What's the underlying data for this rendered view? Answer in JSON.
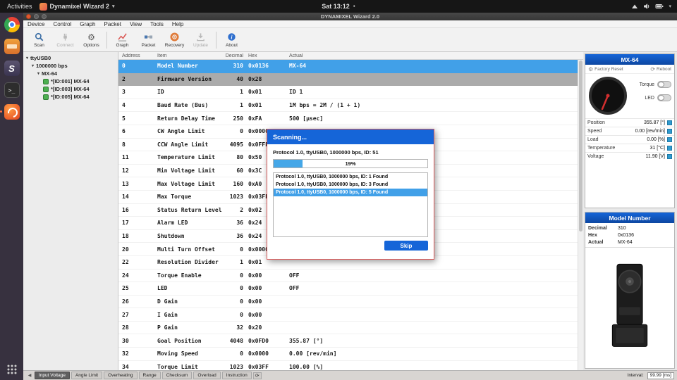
{
  "colors": {
    "accent_blue": "#1565d8",
    "selection_blue": "#41a0e8",
    "inactive_selection_gray": "#ababab",
    "progress_fill": "#45a7e8",
    "ubuntu_orange": "#e95420",
    "panel_bg": "#efefef"
  },
  "desktop": {
    "topbar": {
      "activities": "Activities",
      "app_menu": "Dynamixel Wizard 2",
      "caret": "▾",
      "clock": "Sat 13:12",
      "notification_dot": "●",
      "icons": [
        "network-icon",
        "volume-icon",
        "battery-icon",
        "chevron-down-icon"
      ]
    },
    "dock": {
      "items": [
        "chrome-icon",
        "files-icon",
        "s-app-icon",
        "terminal-icon",
        "dynamixel-wizard-icon"
      ],
      "active_item": "dynamixel-wizard-icon",
      "show_apps": "Show Applications"
    }
  },
  "window": {
    "title": "DYNAMIXEL Wizard 2.0",
    "menu": [
      "Device",
      "Control",
      "Graph",
      "Packet",
      "View",
      "Tools",
      "Help"
    ],
    "toolbar": [
      {
        "label": "Scan",
        "icon": "search-icon",
        "enabled": true
      },
      {
        "label": "Connect",
        "icon": "plug-icon",
        "enabled": false
      },
      {
        "label": "Options",
        "icon": "gear-icon",
        "enabled": true
      },
      {
        "separator": true
      },
      {
        "label": "Graph",
        "icon": "graph-icon",
        "enabled": true
      },
      {
        "label": "Packet",
        "icon": "packet-icon",
        "enabled": true
      },
      {
        "label": "Recovery",
        "icon": "recovery-icon",
        "enabled": true
      },
      {
        "label": "Update",
        "icon": "update-icon",
        "enabled": false
      },
      {
        "separator": true
      },
      {
        "label": "About",
        "icon": "info-icon",
        "enabled": true
      }
    ]
  },
  "tree": {
    "nodes": [
      {
        "label": "ttyUSB0",
        "level": 0
      },
      {
        "label": "1000000 bps",
        "level": 1
      },
      {
        "label": "MX-64",
        "level": 2
      }
    ],
    "devices": [
      "*[ID:001] MX-64",
      "*[ID:003] MX-64",
      "*[ID:005] MX-64"
    ]
  },
  "table": {
    "headers": [
      "Address",
      "Item",
      "Decimal",
      "Hex",
      "Actual"
    ],
    "rows": [
      {
        "address": "0",
        "item": "Model Number",
        "decimal": "310",
        "hex": "0x0136",
        "actual": "MX-64",
        "state": "selected"
      },
      {
        "address": "2",
        "item": "Firmware Version",
        "decimal": "40",
        "hex": "0x28",
        "actual": "",
        "state": "inactive"
      },
      {
        "address": "3",
        "item": "ID",
        "decimal": "1",
        "hex": "0x01",
        "actual": "ID 1",
        "state": ""
      },
      {
        "address": "4",
        "item": "Baud Rate (Bus)",
        "decimal": "1",
        "hex": "0x01",
        "actual": "1M bps = 2M / (1 + 1)",
        "state": ""
      },
      {
        "address": "5",
        "item": "Return Delay Time",
        "decimal": "250",
        "hex": "0xFA",
        "actual": "500 [μsec]",
        "state": ""
      },
      {
        "address": "6",
        "item": "CW Angle Limit",
        "decimal": "0",
        "hex": "0x0000",
        "actual": "",
        "state": ""
      },
      {
        "address": "8",
        "item": "CCW Angle Limit",
        "decimal": "4095",
        "hex": "0x0FFF",
        "actual": "",
        "state": ""
      },
      {
        "address": "11",
        "item": "Temperature Limit",
        "decimal": "80",
        "hex": "0x50",
        "actual": "",
        "state": ""
      },
      {
        "address": "12",
        "item": "Min Voltage Limit",
        "decimal": "60",
        "hex": "0x3C",
        "actual": "",
        "state": ""
      },
      {
        "address": "13",
        "item": "Max Voltage Limit",
        "decimal": "160",
        "hex": "0xA0",
        "actual": "",
        "state": ""
      },
      {
        "address": "14",
        "item": "Max Torque",
        "decimal": "1023",
        "hex": "0x03FF",
        "actual": "",
        "state": ""
      },
      {
        "address": "16",
        "item": "Status Return Level",
        "decimal": "2",
        "hex": "0x02",
        "actual": "",
        "state": ""
      },
      {
        "address": "17",
        "item": "Alarm LED",
        "decimal": "36",
        "hex": "0x24",
        "actual": "",
        "state": ""
      },
      {
        "address": "18",
        "item": "Shutdown",
        "decimal": "36",
        "hex": "0x24",
        "actual": "",
        "state": ""
      },
      {
        "address": "20",
        "item": "Multi Turn Offset",
        "decimal": "0",
        "hex": "0x0000",
        "actual": "",
        "state": ""
      },
      {
        "address": "22",
        "item": "Resolution Divider",
        "decimal": "1",
        "hex": "0x01",
        "actual": "",
        "state": ""
      },
      {
        "address": "24",
        "item": "Torque Enable",
        "decimal": "0",
        "hex": "0x00",
        "actual": "OFF",
        "state": ""
      },
      {
        "address": "25",
        "item": "LED",
        "decimal": "0",
        "hex": "0x00",
        "actual": "OFF",
        "state": ""
      },
      {
        "address": "26",
        "item": "D Gain",
        "decimal": "0",
        "hex": "0x00",
        "actual": "",
        "state": ""
      },
      {
        "address": "27",
        "item": "I Gain",
        "decimal": "0",
        "hex": "0x00",
        "actual": "",
        "state": ""
      },
      {
        "address": "28",
        "item": "P Gain",
        "decimal": "32",
        "hex": "0x20",
        "actual": "",
        "state": ""
      },
      {
        "address": "30",
        "item": "Goal Position",
        "decimal": "4048",
        "hex": "0x0FD0",
        "actual": "355.87 [°]",
        "state": ""
      },
      {
        "address": "32",
        "item": "Moving Speed",
        "decimal": "0",
        "hex": "0x0000",
        "actual": "0.00 [rev/min]",
        "state": ""
      },
      {
        "address": "34",
        "item": "Torque Limit",
        "decimal": "1023",
        "hex": "0x03FF",
        "actual": "100.00 [%]",
        "state": ""
      }
    ]
  },
  "dialog": {
    "title": "Scanning...",
    "status": "Protocol 1.0, ttyUSB0, 1000000 bps, ID: 51",
    "progress_percent": 19,
    "progress_label": "19%",
    "results": [
      {
        "text": "Protocol 1.0, ttyUSB0, 1000000 bps, ID: 1 Found",
        "selected": false
      },
      {
        "text": "Protocol 1.0, ttyUSB0, 1000000 bps, ID: 3 Found",
        "selected": false
      },
      {
        "text": "Protocol 1.0, ttyUSB0, 1000000 bps, ID: 5 Found",
        "selected": true
      }
    ],
    "skip_label": "Skip"
  },
  "device_panel": {
    "title": "MX-64",
    "factory_reset": "Factory Reset",
    "reboot": "Reboot",
    "toggles": [
      {
        "label": "Torque",
        "state": "off"
      },
      {
        "label": "LED",
        "state": "off"
      }
    ],
    "stats": [
      {
        "label": "Position",
        "value": "355.87 [°]"
      },
      {
        "label": "Speed",
        "value": "0.00 [rev/min]"
      },
      {
        "label": "Load",
        "value": "0.00 [%]"
      },
      {
        "label": "Temperature",
        "value": "31 [°C]"
      },
      {
        "label": "Voltage",
        "value": "11.90 [V]"
      }
    ]
  },
  "item_panel": {
    "title": "Model Number",
    "rows": [
      {
        "label": "Decimal",
        "value": "310"
      },
      {
        "label": "Hex",
        "value": "0x0136"
      },
      {
        "label": "Actual",
        "value": "MX-64"
      }
    ]
  },
  "statusbar": {
    "tabs": [
      "Input Voltage",
      "Angle Limit",
      "Overheating",
      "Range",
      "Checksum",
      "Overload",
      "Instruction"
    ],
    "active_tab": "Input Voltage",
    "interval_label": "Interval:",
    "interval_value": "99.99 [ms]"
  }
}
